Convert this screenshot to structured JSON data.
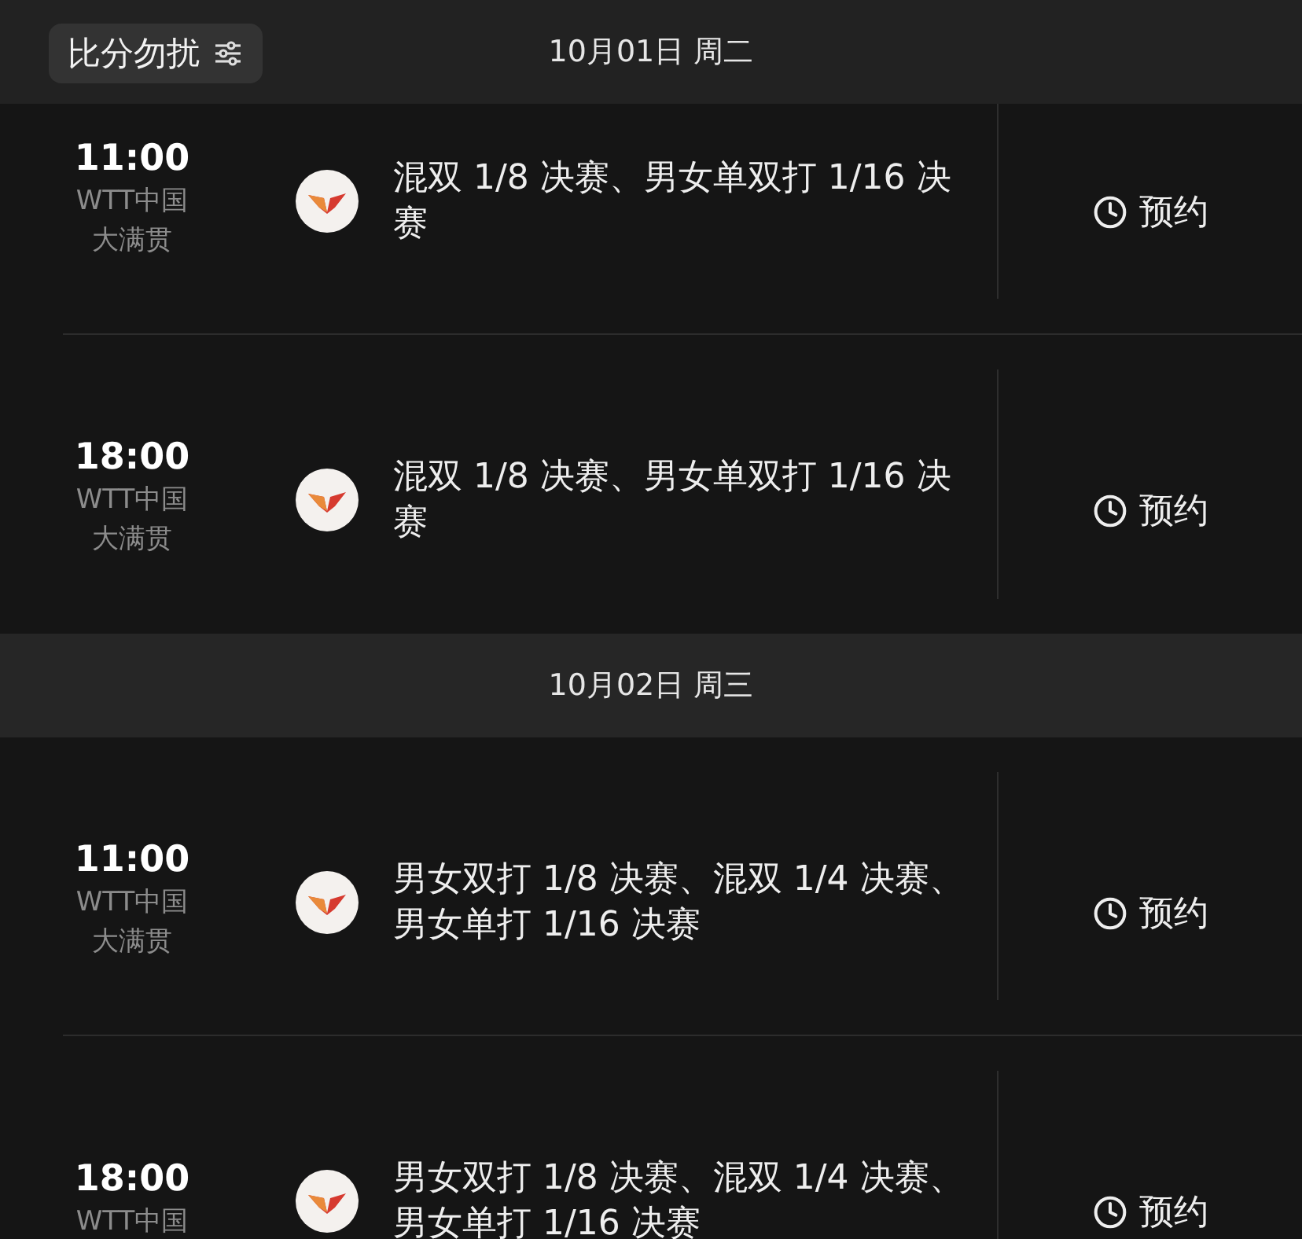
{
  "filter_button": {
    "label": "比分勿扰"
  },
  "sections": [
    {
      "date": "10月01日 周二",
      "matches": [
        {
          "time": "11:00",
          "league": [
            "WTT中国",
            "大满贯"
          ],
          "title": "混双 1/8 决赛、男女单双打 1/16 决赛",
          "action": "预约"
        },
        {
          "time": "18:00",
          "league": [
            "WTT中国",
            "大满贯"
          ],
          "title": "混双 1/8 决赛、男女单双打 1/16 决赛",
          "action": "预约"
        }
      ]
    },
    {
      "date": "10月02日 周三",
      "matches": [
        {
          "time": "11:00",
          "league": [
            "WTT中国",
            "大满贯"
          ],
          "title": "男女双打 1/8 决赛、混双 1/4 决赛、男女单打 1/16 决赛",
          "action": "预约"
        },
        {
          "time": "18:00",
          "league": [
            "WTT中国"
          ],
          "title": "男女双打 1/8 决赛、混双 1/4 决赛、男女单打 1/16 决赛",
          "action": "预约"
        }
      ]
    }
  ]
}
